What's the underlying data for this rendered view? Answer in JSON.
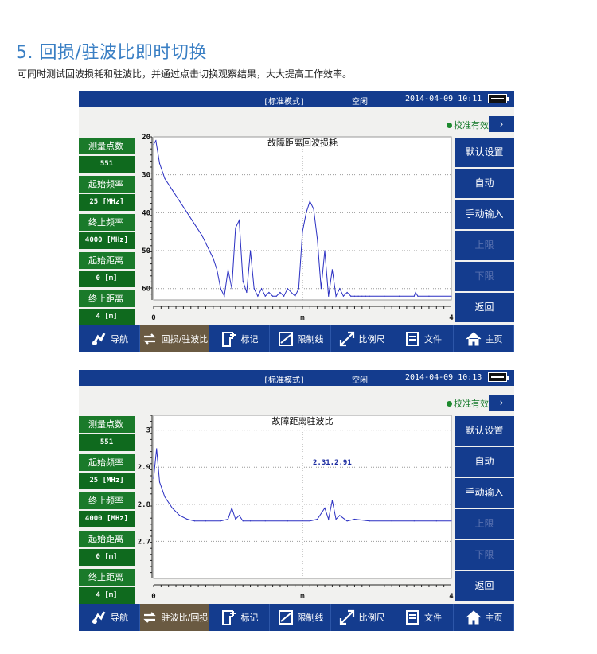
{
  "page": {
    "title": "5. 回损/驻波比即时切换",
    "subtitle": "可同时测试回波损耗和驻波比，并通过点击切换观察结果，大大提高工作效率。"
  },
  "screens": [
    {
      "status": {
        "mode": "[标准模式]",
        "state": "空闲",
        "datetime": "2014-04-09 10:11"
      },
      "calibration": {
        "label": "校准有效",
        "arrow": "›"
      },
      "params": [
        {
          "label": "测量点数",
          "value": "551"
        },
        {
          "label": "起始频率",
          "value": "25 [MHz]"
        },
        {
          "label": "终止频率",
          "value": "4000 [MHz]"
        },
        {
          "label": "起始距离",
          "value": "0 [m]"
        },
        {
          "label": "终止距离",
          "value": "4 [m]"
        }
      ],
      "side_buttons": [
        {
          "label": "默认设置",
          "enabled": true
        },
        {
          "label": "自动",
          "enabled": true
        },
        {
          "label": "手动输入",
          "enabled": true
        },
        {
          "label": "上限",
          "enabled": false
        },
        {
          "label": "下限",
          "enabled": false
        },
        {
          "label": "返回",
          "enabled": true
        }
      ],
      "bottom_menu": [
        {
          "label": "导航",
          "icon": "navigation-icon"
        },
        {
          "label": "回损/驻波比",
          "icon": "swap-icon",
          "active": true
        },
        {
          "label": "标记",
          "icon": "marker-icon"
        },
        {
          "label": "限制线",
          "icon": "limit-line-icon"
        },
        {
          "label": "比例尺",
          "icon": "scale-icon"
        },
        {
          "label": "文件",
          "icon": "file-icon"
        },
        {
          "label": "主页",
          "icon": "home-icon"
        }
      ]
    },
    {
      "status": {
        "mode": "[标准模式]",
        "state": "空闲",
        "datetime": "2014-04-09 10:13"
      },
      "calibration": {
        "label": "校准有效",
        "arrow": "›"
      },
      "params": [
        {
          "label": "测量点数",
          "value": "551"
        },
        {
          "label": "起始频率",
          "value": "25 [MHz]"
        },
        {
          "label": "终止频率",
          "value": "4000 [MHz]"
        },
        {
          "label": "起始距离",
          "value": "0 [m]"
        },
        {
          "label": "终止距离",
          "value": "4 [m]"
        }
      ],
      "side_buttons": [
        {
          "label": "默认设置",
          "enabled": true
        },
        {
          "label": "自动",
          "enabled": true
        },
        {
          "label": "手动输入",
          "enabled": true
        },
        {
          "label": "上限",
          "enabled": false
        },
        {
          "label": "下限",
          "enabled": false
        },
        {
          "label": "返回",
          "enabled": true
        }
      ],
      "bottom_menu": [
        {
          "label": "导航",
          "icon": "navigation-icon"
        },
        {
          "label": "驻波比/回损",
          "icon": "swap-icon",
          "active": true
        },
        {
          "label": "标记",
          "icon": "marker-icon"
        },
        {
          "label": "限制线",
          "icon": "limit-line-icon"
        },
        {
          "label": "比例尺",
          "icon": "scale-icon"
        },
        {
          "label": "文件",
          "icon": "file-icon"
        },
        {
          "label": "主页",
          "icon": "home-icon"
        }
      ]
    }
  ],
  "chart_data": [
    {
      "type": "line",
      "title": "故障距离回波损耗",
      "xlabel": "m",
      "x_ticks": [
        "0",
        "m",
        "4"
      ],
      "y_ticks": [
        "20",
        "30",
        "40",
        "50",
        "60"
      ],
      "ylim": [
        20,
        63
      ],
      "y_inverted": true,
      "xlim": [
        0,
        4
      ],
      "grid": true,
      "line_color": "#2a2fc2",
      "series": [
        {
          "x": [
            0,
            0.03,
            0.08,
            0.15,
            0.25,
            0.35,
            0.45,
            0.55,
            0.65,
            0.75,
            0.8,
            0.85,
            0.9,
            0.95,
            1.0,
            1.05,
            1.1,
            1.15,
            1.2,
            1.25,
            1.3,
            1.35,
            1.4,
            1.45,
            1.5,
            1.55,
            1.6,
            1.65,
            1.7,
            1.75,
            1.8,
            1.85,
            1.9,
            1.95,
            2.0,
            2.05,
            2.1,
            2.15,
            2.2,
            2.25,
            2.3,
            2.35,
            2.4,
            2.45,
            2.5,
            2.55,
            2.6,
            2.65,
            2.7,
            2.75,
            2.8,
            2.85,
            2.9,
            3.0,
            3.1,
            3.3,
            3.5,
            3.52,
            3.55,
            3.7,
            4.0
          ],
          "y": [
            22,
            21,
            27,
            31,
            34,
            37,
            40,
            43,
            46,
            50,
            52,
            55,
            60,
            62,
            55,
            60,
            44,
            42,
            58,
            61,
            50,
            60,
            62,
            60,
            62,
            61,
            62,
            62,
            61,
            62,
            60,
            61,
            62,
            60,
            45,
            40,
            37,
            39,
            47,
            60,
            50,
            62,
            55,
            62,
            60,
            62,
            61,
            62,
            62,
            62,
            62,
            62,
            62,
            62,
            62,
            62,
            62,
            61,
            62,
            62,
            62
          ]
        }
      ]
    },
    {
      "type": "line",
      "title": "故障距离驻波比",
      "xlabel": "m",
      "x_ticks": [
        "0",
        "m",
        "4"
      ],
      "y_ticks": [
        "3",
        "2.9",
        "2.8",
        "2.7"
      ],
      "ylim": [
        2.6,
        3.04
      ],
      "xlim": [
        0,
        4
      ],
      "grid": true,
      "annotation": "2.31,2.91",
      "line_color": "#2a2fc2",
      "series": [
        {
          "x": [
            0,
            0.04,
            0.08,
            0.15,
            0.25,
            0.35,
            0.45,
            0.55,
            0.7,
            0.9,
            1.0,
            1.05,
            1.1,
            1.15,
            1.2,
            1.3,
            1.5,
            1.8,
            2.1,
            2.2,
            2.3,
            2.35,
            2.4,
            2.45,
            2.5,
            2.6,
            2.7,
            2.9,
            3.2,
            3.5,
            3.8,
            4.0
          ],
          "y": [
            2.87,
            2.95,
            2.86,
            2.82,
            2.79,
            2.77,
            2.76,
            2.755,
            2.755,
            2.755,
            2.76,
            2.79,
            2.76,
            2.77,
            2.755,
            2.755,
            2.755,
            2.755,
            2.755,
            2.76,
            2.79,
            2.76,
            2.81,
            2.76,
            2.77,
            2.755,
            2.76,
            2.755,
            2.755,
            2.755,
            2.755,
            2.755
          ]
        }
      ]
    }
  ]
}
